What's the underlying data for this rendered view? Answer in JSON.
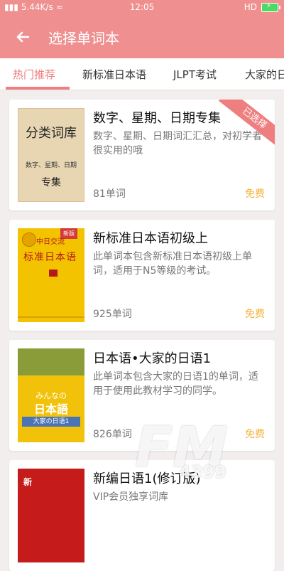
{
  "statusbar": {
    "left": "5.44K/s",
    "time": "12:05",
    "right": "HD"
  },
  "appbar": {
    "title": "选择单词本"
  },
  "tabs": [
    {
      "label": "热门推荐",
      "active": true
    },
    {
      "label": "新标准日本语",
      "active": false
    },
    {
      "label": "JLPT考试",
      "active": false
    },
    {
      "label": "大家的日",
      "active": false
    }
  ],
  "cards": [
    {
      "title": "数字、星期、日期专集",
      "desc": "数字、星期、日期词汇汇总，对初学者很实用的哦",
      "count": "81单词",
      "price": "免费",
      "ribbon": "已选择",
      "cover": {
        "big": "分类词库",
        "small": "数字、星期、日期",
        "ztitle": "专集"
      }
    },
    {
      "title": "新标准日本语初级上",
      "desc": "此单词本包含新标准日本语初级上单词，适用于N5等级的考试。",
      "count": "925单词",
      "price": "免费",
      "cover": {
        "tag": "新版",
        "l1": "中日交流",
        "l2": "标准日本语"
      }
    },
    {
      "title": "日本语•大家的日语1",
      "desc": "此单词本包含大家的日语1的单词，适用于使用此教材学习的同学。",
      "count": "826单词",
      "price": "免费",
      "cover": {
        "l1": "みんなの",
        "l2": "日本語",
        "band": "大家の日语1"
      }
    },
    {
      "title": "新编日语1(修订版)",
      "desc": "VIP会员独享词库",
      "cover": {
        "t": "新"
      }
    }
  ],
  "watermark": {
    "main": "FM",
    "sub": "4399"
  }
}
